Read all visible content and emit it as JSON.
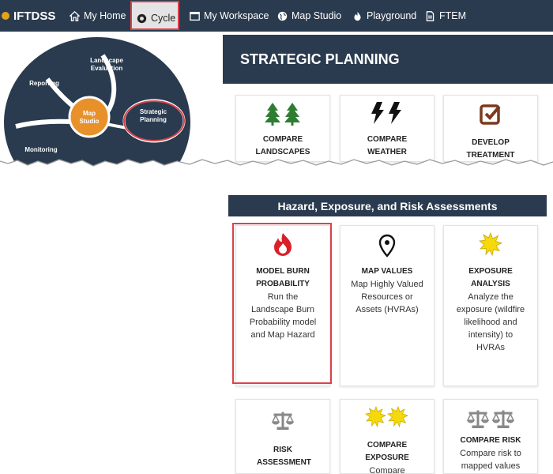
{
  "nav": {
    "brand": "IFTDSS",
    "items": [
      {
        "label": "My Home",
        "icon": "home-icon"
      },
      {
        "label": "Cycle",
        "icon": "cycle-icon"
      },
      {
        "label": "My Workspace",
        "icon": "window-icon"
      },
      {
        "label": "Map Studio",
        "icon": "globe-icon"
      },
      {
        "label": "Playground",
        "icon": "flame-icon"
      },
      {
        "label": "FTEM",
        "icon": "document-icon"
      }
    ]
  },
  "cycle": {
    "center": "Map\nStudio",
    "segments": [
      "Landscape\nEvaluation",
      "Strategic\nPlanning",
      "Reporting",
      "Monitoring"
    ]
  },
  "strategic": {
    "title": "STRATEGIC PLANNING",
    "cards": [
      {
        "title": "COMPARE LANDSCAPES",
        "icon": "trees-icon"
      },
      {
        "title": "COMPARE WEATHER",
        "icon": "lightning-icon"
      },
      {
        "title": "DEVELOP TREATMENT",
        "icon": "checkbox-icon"
      }
    ]
  },
  "hazard": {
    "title": "Hazard, Exposure, and Risk Assessments",
    "cards": [
      {
        "title": "MODEL BURN PROBABILITY",
        "desc": "Run the Landscape Burn Probability model and Map Hazard",
        "icon": "fire-icon"
      },
      {
        "title": "MAP VALUES",
        "desc": "Map Highly Valued Resources or Assets (HVRAs)",
        "icon": "map-pin-icon"
      },
      {
        "title": "EXPOSURE ANALYSIS",
        "desc": "Analyze the exposure (wildfire likelihood and intensity) to HVRAs",
        "icon": "starburst-icon"
      },
      {
        "title": "RISK ASSESSMENT",
        "desc": "",
        "icon": "scales-icon"
      },
      {
        "title": "COMPARE EXPOSURE",
        "desc": "Compare",
        "icon": "double-starburst-icon"
      },
      {
        "title": "COMPARE RISK",
        "desc": "Compare risk to mapped values",
        "icon": "double-scales-icon"
      }
    ]
  },
  "colors": {
    "nav": "#2a3b4f",
    "highlight": "#d9434b",
    "tree": "#2f7d32",
    "fire": "#d9202a",
    "sun": "#f5d90a"
  }
}
